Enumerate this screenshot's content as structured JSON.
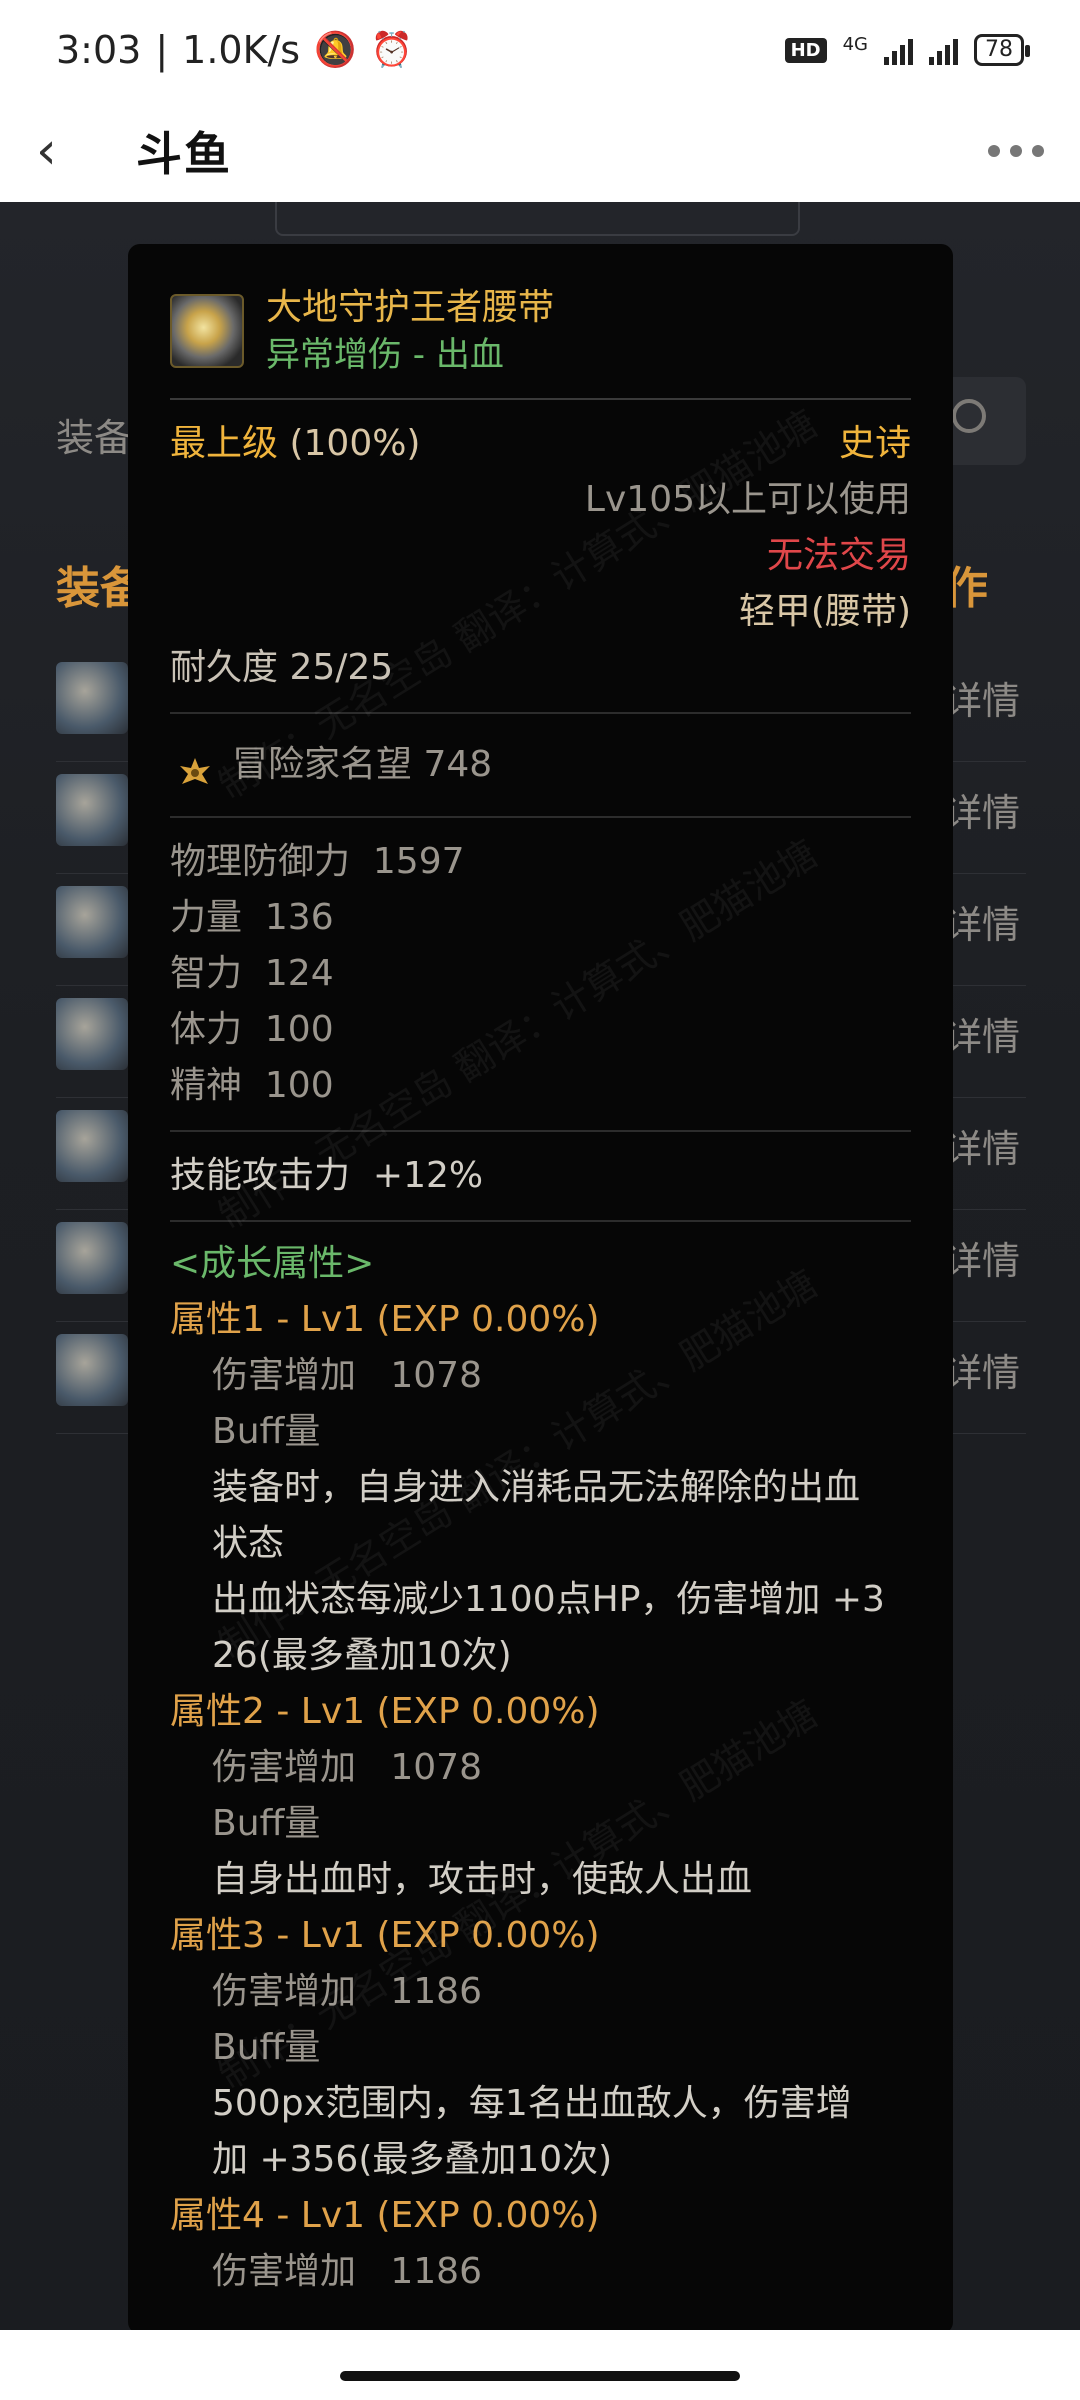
{
  "status_bar": {
    "time": "3:03",
    "speed": "1.0K/s",
    "network": "4G",
    "hd": "HD",
    "battery": "78"
  },
  "app_bar": {
    "title": "斗鱼"
  },
  "background": {
    "row_label": "装备",
    "section_head": "装备",
    "section_head_right": "作",
    "detail_label": "详情",
    "items": [
      {
        "detail": "详情"
      },
      {
        "detail": "详情"
      },
      {
        "detail": "详情"
      },
      {
        "detail": "详情"
      },
      {
        "detail": "详情"
      },
      {
        "detail": "详情"
      },
      {
        "detail": "详情"
      }
    ]
  },
  "tooltip": {
    "name": "大地守护王者腰带",
    "subtitle": "异常增伤 - 出血",
    "grade": "最上级",
    "grade_pct": "(100%)",
    "rarity": "史诗",
    "level_req": "Lv105以上可以使用",
    "trade": "无法交易",
    "type": "轻甲(腰带)",
    "durability": "耐久度 25/25",
    "renown": "冒险家名望 748",
    "stats": [
      {
        "label": "物理防御力",
        "value": "1597"
      },
      {
        "label": "力量",
        "value": "136"
      },
      {
        "label": "智力",
        "value": "124"
      },
      {
        "label": "体力",
        "value": "100"
      },
      {
        "label": "精神",
        "value": "100"
      }
    ],
    "skill_attack": "技能攻击力",
    "skill_attack_value": "+12%",
    "growth_title": "<成长属性>",
    "attributes": [
      {
        "title": "属性1 - Lv1 (EXP 0.00%)",
        "dmg_label": "伤害增加",
        "dmg_value": "1078",
        "buff": "Buff量",
        "desc": [
          "装备时，自身进入消耗品无法解除的出血",
          "状态",
          "出血状态每减少1100点HP，伤害增加 +3",
          "26(最多叠加10次)"
        ]
      },
      {
        "title": "属性2 - Lv1 (EXP 0.00%)",
        "dmg_label": "伤害增加",
        "dmg_value": "1078",
        "buff": "Buff量",
        "desc": [
          "自身出血时，攻击时，使敌人出血"
        ]
      },
      {
        "title": "属性3 - Lv1 (EXP 0.00%)",
        "dmg_label": "伤害增加",
        "dmg_value": "1186",
        "buff": "Buff量",
        "desc": [
          "500px范围内，每1名出血敌人，伤害增",
          "加 +356(最多叠加10次)"
        ]
      },
      {
        "title": "属性4 - Lv1 (EXP 0.00%)",
        "dmg_label": "伤害增加",
        "dmg_value": "1186"
      }
    ],
    "watermark": "制作：无名空岛 翻译：计算式、肥猫池塘"
  },
  "colors": {
    "gold": "#f0b43c",
    "green": "#6ab86a",
    "red": "#e0474a",
    "orange": "#e0a24a"
  }
}
